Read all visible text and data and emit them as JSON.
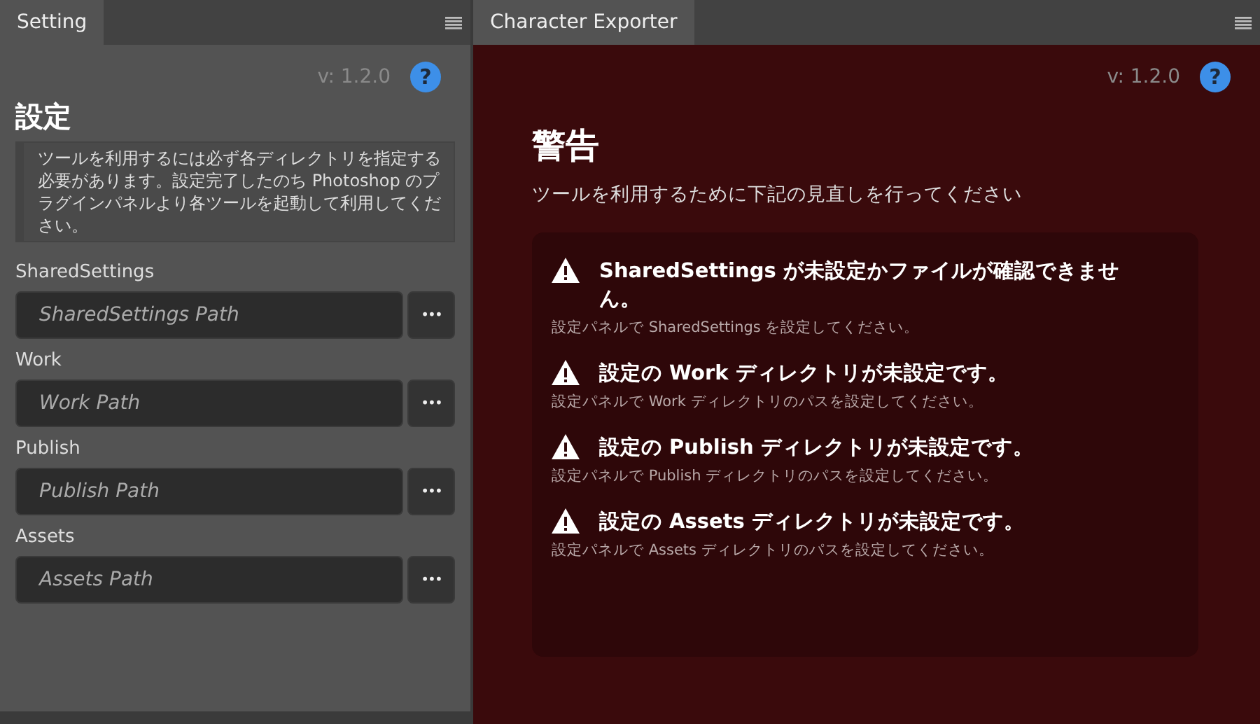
{
  "settings_panel": {
    "tab": "Setting",
    "version": "v: 1.2.0",
    "help": "?",
    "title": "設定",
    "note": "ツールを利用するには必ず各ディレクトリを指定する必要があります。設定完了したのち Photoshop のプラグインパネルより各ツールを起動して利用してください。",
    "fields": [
      {
        "label": "SharedSettings",
        "placeholder": "SharedSettings Path",
        "button": "•••"
      },
      {
        "label": "Work",
        "placeholder": "Work Path",
        "button": "•••"
      },
      {
        "label": "Publish",
        "placeholder": "Publish Path",
        "button": "•••"
      },
      {
        "label": "Assets",
        "placeholder": "Assets Path",
        "button": "•••"
      }
    ]
  },
  "exporter_panel": {
    "tab": "Character Exporter",
    "version": "v: 1.2.0",
    "help": "?",
    "dialog": {
      "title": "警告",
      "message": "ツールを利用するために下記の見直しを行ってください",
      "warnings": [
        {
          "title": "SharedSettings が未設定かファイルが確認できません。",
          "detail": "設定パネルで SharedSettings を設定してください。"
        },
        {
          "title": "設定の Work ディレクトリが未設定です。",
          "detail": "設定パネルで Work ディレクトリのパスを設定してください。"
        },
        {
          "title": "設定の Publish ディレクトリが未設定です。",
          "detail": "設定パネルで Publish ディレクトリのパスを設定してください。"
        },
        {
          "title": "設定の Assets ディレクトリが未設定です。",
          "detail": "設定パネルで Assets ディレクトリのパスを設定してください。"
        }
      ]
    }
  }
}
